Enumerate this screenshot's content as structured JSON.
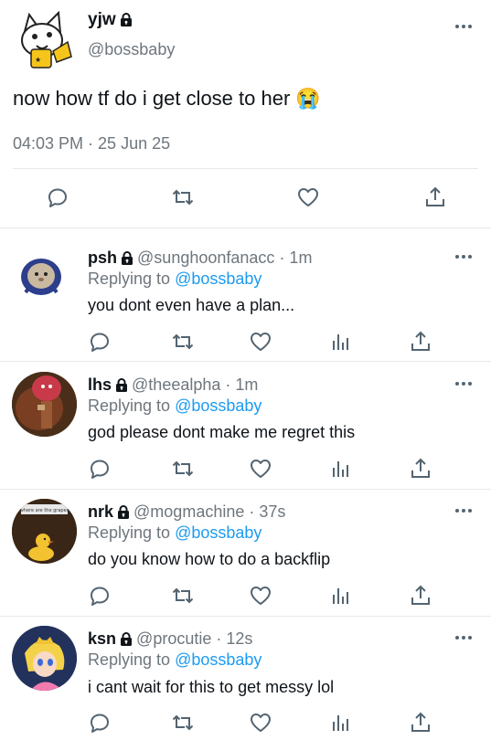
{
  "main_tweet": {
    "display_name": "yjw",
    "handle": "@bossbaby",
    "text": "now how tf do i get close to her 😭",
    "timestamp": "04:03 PM · 25 Jun 25",
    "locked": true,
    "actions": [
      "reply-icon",
      "retweet-icon",
      "like-icon",
      "share-icon"
    ]
  },
  "replies": [
    {
      "display_name": "psh",
      "handle": "@sunghoonfanacc",
      "age": "· 1m",
      "replying_prefix": "Replying to",
      "replying_to": "@bossbaby",
      "text": "you dont even have a plan..."
    },
    {
      "display_name": "lhs",
      "handle": "@theealpha",
      "age": "· 1m",
      "replying_prefix": "Replying to",
      "replying_to": "@bossbaby",
      "text": "god please dont make me regret this"
    },
    {
      "display_name": "nrk",
      "handle": "@mogmachine",
      "age": "· 37s",
      "replying_prefix": "Replying to",
      "replying_to": "@bossbaby",
      "text": "do you know how to do a backflip",
      "avatar_caption": "where are the grapes"
    },
    {
      "display_name": "ksn",
      "handle": "@procutie",
      "age": "· 12s",
      "replying_prefix": "Replying to",
      "replying_to": "@bossbaby",
      "text": "i cant wait for this to get messy lol"
    }
  ],
  "colors": {
    "accent_link": "#1d9bf0",
    "muted_text": "#6e767d",
    "icon_gray": "#536471",
    "divider": "#e6e9ec"
  }
}
